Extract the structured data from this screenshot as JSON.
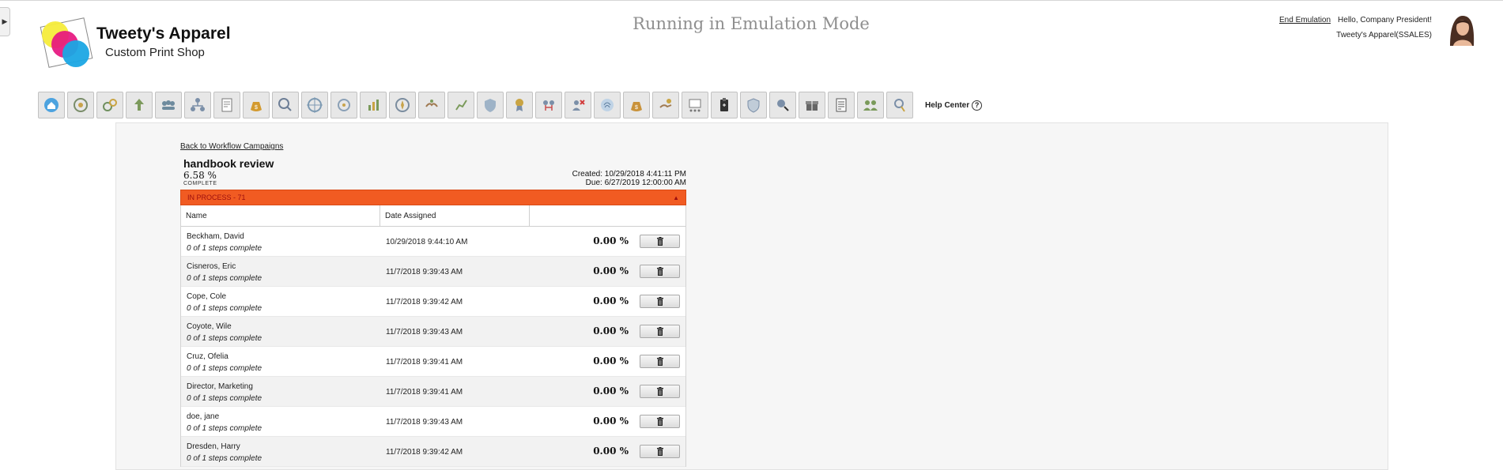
{
  "header": {
    "company_name": "Tweety's Apparel",
    "company_tagline": "Custom Print Shop",
    "emulation_banner": "Running in Emulation Mode",
    "end_emulation_link": "End Emulation",
    "greeting": "Hello, Company President!",
    "account": "Tweety's Apparel(SSALES)"
  },
  "toolbar": {
    "icons": [
      "home-icon",
      "target-icon",
      "gears-icon",
      "upload-icon",
      "group-icon",
      "org-chart-icon",
      "document-edit-icon",
      "money-bag-icon",
      "search-people-icon",
      "crosshair-icon",
      "crosshair-alt-icon",
      "hand-chart-icon",
      "compass-icon",
      "handshake-icon",
      "growth-icon",
      "shield-icon",
      "award-icon",
      "people-link-icon",
      "user-remove-icon",
      "fingerprint-icon",
      "money-bag-alt-icon",
      "hand-coins-icon",
      "calendar-grid-icon",
      "clipboard-icon",
      "badge-icon",
      "magnify-user-icon",
      "gift-icon",
      "form-icon",
      "team-icon",
      "certificate-icon"
    ],
    "help_center_label": "Help Center",
    "help_glyph": "?"
  },
  "campaign": {
    "back_link": "Back to Workflow Campaigns",
    "title": "handbook review",
    "percent": "6.58 %",
    "status": "COMPLETE",
    "created": "Created: 10/29/2018 4:41:11 PM",
    "due": "Due: 6/27/2019 12:00:00 AM",
    "section_label": "IN PROCESS - 71",
    "section_arrow": "▲"
  },
  "table": {
    "columns": [
      "Name",
      "Date Assigned",
      ""
    ],
    "rows": [
      {
        "name": "Beckham, David",
        "steps": "0 of 1 steps complete",
        "date": "10/29/2018 9:44:10 AM",
        "percent": "0.00 %"
      },
      {
        "name": "Cisneros, Eric",
        "steps": "0 of 1 steps complete",
        "date": "11/7/2018 9:39:43 AM",
        "percent": "0.00 %"
      },
      {
        "name": "Cope, Cole",
        "steps": "0 of 1 steps complete",
        "date": "11/7/2018 9:39:42 AM",
        "percent": "0.00 %"
      },
      {
        "name": "Coyote, Wile",
        "steps": "0 of 1 steps complete",
        "date": "11/7/2018 9:39:43 AM",
        "percent": "0.00 %"
      },
      {
        "name": "Cruz, Ofelia",
        "steps": "0 of 1 steps complete",
        "date": "11/7/2018 9:39:41 AM",
        "percent": "0.00 %"
      },
      {
        "name": "Director, Marketing",
        "steps": "0 of 1 steps complete",
        "date": "11/7/2018 9:39:41 AM",
        "percent": "0.00 %"
      },
      {
        "name": "doe, jane",
        "steps": "0 of 1 steps complete",
        "date": "11/7/2018 9:39:43 AM",
        "percent": "0.00 %"
      },
      {
        "name": "Dresden, Harry",
        "steps": "0 of 1 steps complete",
        "date": "11/7/2018 9:39:42 AM",
        "percent": "0.00 %"
      }
    ]
  },
  "colors": {
    "accent_orange": "#f15b22",
    "status_text": "#9d0f0f",
    "toolbar_button": "#e7e7e7",
    "logo_yellow": "#f5ec3b",
    "logo_magenta": "#e6157f",
    "logo_cyan": "#1ba7e4"
  }
}
